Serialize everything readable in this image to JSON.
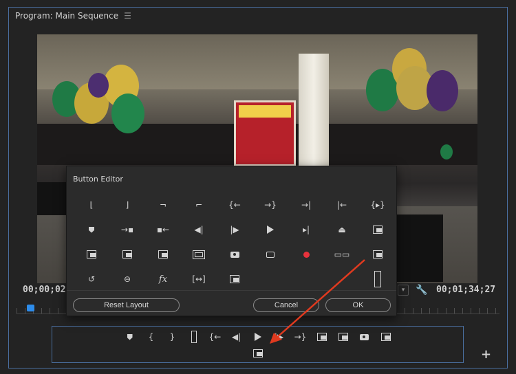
{
  "panel": {
    "title": "Program: Main Sequence",
    "menu_icon": "hamburger-icon"
  },
  "timecode": {
    "current": "00;00;02",
    "duration": "00;01;34;27"
  },
  "colors": {
    "accent": "#2d8ceb",
    "frame": "#4a6fa0",
    "record": "#e8323c",
    "arrow": "#e03a1f",
    "poster": "#b6212a"
  },
  "dialog": {
    "title": "Button Editor",
    "grid": [
      [
        "{",
        "}",
        "-}",
        "}-",
        "{←",
        "→}",
        "→|",
        "|←",
        "{▸}"
      ],
      [
        "marker",
        "→▪",
        "▪←",
        "◀|",
        "|▶",
        "play",
        "▸|",
        "export",
        "lift"
      ],
      [
        "insert",
        "overwrite",
        "extract",
        "safe-margins",
        "camera",
        "comment",
        "record",
        "multicam",
        "vr-video"
      ],
      [
        "loop",
        "global-fx",
        "fx",
        "[↔]",
        "compare",
        "",
        "",
        "",
        "tall"
      ]
    ],
    "fx_label": "fx",
    "reset_label": "Reset Layout",
    "cancel_label": "Cancel",
    "ok_label": "OK"
  },
  "button_bar": {
    "row1": [
      "marker",
      "{",
      "}",
      "|",
      "{←",
      "◀|",
      "▶",
      "|▶",
      "→}",
      "lift",
      "extract",
      "camera",
      "compare"
    ],
    "row2": [
      "vr-video"
    ]
  },
  "add_label": "+"
}
